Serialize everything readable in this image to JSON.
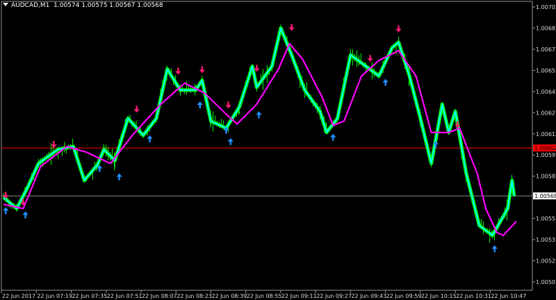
{
  "header": {
    "symbol": "AUDCAD,M1",
    "ohlc": "1.00574 1.00575 1.00567 1.00568"
  },
  "chart_data": {
    "type": "line",
    "date": "22 Jun 2017",
    "colors": {
      "background": "#000000",
      "candles": "#00ff00",
      "price_line": "#00ffff",
      "moving_average": "#ff00ff",
      "sell_arrow": "#ff1a75",
      "buy_arrow": "#1e90ff",
      "red_level": "#ff0000",
      "current_price": "#ffffff"
    },
    "ylim": [
      1.005,
      1.00707
    ],
    "y_ticks": [
      "1.00702",
      "1.00687",
      "1.00672",
      "1.00657",
      "1.00642",
      "1.00627",
      "1.00612",
      "1.00597",
      "1.00582",
      "1.00552",
      "1.00537",
      "1.00522",
      "1.00507"
    ],
    "x_ticks": [
      {
        "time": "07:03",
        "label": "22 Jun 2017"
      },
      {
        "time": "07:19",
        "label": "22 Jun 07:19"
      },
      {
        "time": "07:35",
        "label": "22 Jun 07:35"
      },
      {
        "time": "07:51",
        "label": "22 Jun 07:51"
      },
      {
        "time": "08:07",
        "label": "22 Jun 08:07"
      },
      {
        "time": "08:23",
        "label": "22 Jun 08:23"
      },
      {
        "time": "08:39",
        "label": "22 Jun 08:39"
      },
      {
        "time": "08:55",
        "label": "22 Jun 08:55"
      },
      {
        "time": "09:11",
        "label": "22 Jun 09:11"
      },
      {
        "time": "09:27",
        "label": "22 Jun 09:27"
      },
      {
        "time": "09:43",
        "label": "22 Jun 09:43"
      },
      {
        "time": "09:59",
        "label": "22 Jun 09:59"
      },
      {
        "time": "10:15",
        "label": "22 Jun 10:15"
      },
      {
        "time": "10:31",
        "label": "22 Jun 10:31"
      },
      {
        "time": "10:47",
        "label": "22 Jun 10:47"
      }
    ],
    "levels": {
      "red_line": "1.00602",
      "current_price": "1.00568"
    },
    "close": [
      [
        "07:04",
        1.00567
      ],
      [
        "07:10",
        1.00559
      ],
      [
        "07:15",
        1.00574
      ],
      [
        "07:20",
        1.00591
      ],
      [
        "07:29",
        1.00601
      ],
      [
        "07:36",
        1.00603
      ],
      [
        "07:41",
        1.00579
      ],
      [
        "07:47",
        1.0059
      ],
      [
        "07:50",
        1.00601
      ],
      [
        "07:55",
        1.00593
      ],
      [
        "08:01",
        1.00623
      ],
      [
        "08:08",
        1.00611
      ],
      [
        "08:14",
        1.00623
      ],
      [
        "08:19",
        1.00658
      ],
      [
        "08:25",
        1.00643
      ],
      [
        "08:32",
        1.00643
      ],
      [
        "08:35",
        1.0065
      ],
      [
        "08:39",
        1.00621
      ],
      [
        "08:46",
        1.00616
      ],
      [
        "08:52",
        1.00631
      ],
      [
        "08:58",
        1.0066
      ],
      [
        "09:00",
        1.00645
      ],
      [
        "09:07",
        1.0066
      ],
      [
        "09:11",
        1.00687
      ],
      [
        "09:16",
        1.00668
      ],
      [
        "09:22",
        1.00643
      ],
      [
        "09:29",
        1.00628
      ],
      [
        "09:32",
        1.00613
      ],
      [
        "09:37",
        1.00623
      ],
      [
        "09:43",
        1.00668
      ],
      [
        "09:50",
        1.0066
      ],
      [
        "09:56",
        1.00653
      ],
      [
        "10:02",
        1.00673
      ],
      [
        "10:05",
        1.00677
      ],
      [
        "10:10",
        1.00653
      ],
      [
        "10:15",
        1.00623
      ],
      [
        "10:20",
        1.00591
      ],
      [
        "10:25",
        1.00633
      ],
      [
        "10:28",
        1.00613
      ],
      [
        "10:31",
        1.00628
      ],
      [
        "10:36",
        1.00584
      ],
      [
        "10:42",
        1.00547
      ],
      [
        "10:48",
        1.0054
      ],
      [
        "10:55",
        1.00559
      ],
      [
        "10:57",
        1.00579
      ],
      [
        "10:58",
        1.00568
      ]
    ],
    "moving_average": [
      [
        "07:04",
        1.00562
      ],
      [
        "07:13",
        1.00559
      ],
      [
        "07:21",
        1.00589
      ],
      [
        "07:33",
        1.00603
      ],
      [
        "07:42",
        1.00599
      ],
      [
        "07:53",
        1.00591
      ],
      [
        "08:03",
        1.00611
      ],
      [
        "08:16",
        1.00633
      ],
      [
        "08:27",
        1.00648
      ],
      [
        "08:36",
        1.00641
      ],
      [
        "08:46",
        1.00626
      ],
      [
        "08:51",
        1.00619
      ],
      [
        "09:00",
        1.00633
      ],
      [
        "09:10",
        1.00658
      ],
      [
        "09:15",
        1.00676
      ],
      [
        "09:21",
        1.00665
      ],
      [
        "09:30",
        1.00638
      ],
      [
        "09:35",
        1.00618
      ],
      [
        "09:40",
        1.00621
      ],
      [
        "09:48",
        1.00653
      ],
      [
        "09:56",
        1.00664
      ],
      [
        "10:05",
        1.00671
      ],
      [
        "10:13",
        1.00653
      ],
      [
        "10:20",
        1.00613
      ],
      [
        "10:28",
        1.00613
      ],
      [
        "10:33",
        1.00616
      ],
      [
        "10:41",
        1.00584
      ],
      [
        "10:45",
        1.00559
      ],
      [
        "10:50",
        1.00542
      ],
      [
        "10:53",
        1.0054
      ],
      [
        "10:59",
        1.0055
      ]
    ],
    "sell_arrows": [
      [
        "07:05",
        1.00567
      ],
      [
        "07:13",
        1.00562
      ],
      [
        "07:27",
        1.00603
      ],
      [
        "08:05",
        1.00628
      ],
      [
        "08:24",
        1.00655
      ],
      [
        "08:35",
        1.00656
      ],
      [
        "08:47",
        1.00631
      ],
      [
        "09:00",
        1.00657
      ],
      [
        "09:16",
        1.00686
      ],
      [
        "09:52",
        1.00664
      ],
      [
        "10:05",
        1.00685
      ],
      [
        "10:32",
        1.00617
      ]
    ],
    "buy_arrows": [
      [
        "07:05",
        1.00559
      ],
      [
        "07:14",
        1.00556
      ],
      [
        "07:48",
        1.00589
      ],
      [
        "07:57",
        1.00583
      ],
      [
        "08:11",
        1.0061
      ],
      [
        "08:34",
        1.00634
      ],
      [
        "08:46",
        1.00616
      ],
      [
        "08:48",
        1.00608
      ],
      [
        "09:01",
        1.00627
      ],
      [
        "09:35",
        1.00611
      ],
      [
        "09:59",
        1.0065
      ],
      [
        "10:22",
        1.00606
      ],
      [
        "10:49",
        1.00532
      ]
    ]
  }
}
